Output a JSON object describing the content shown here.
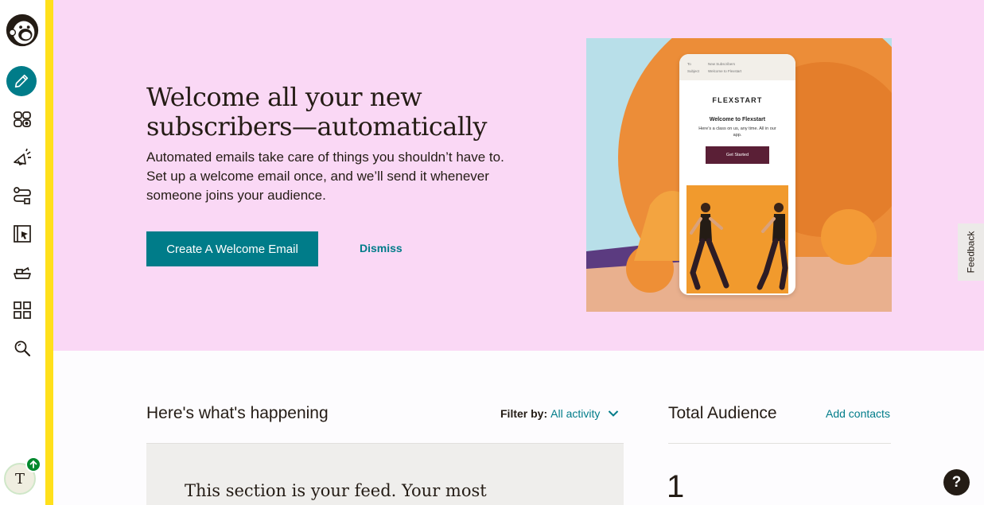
{
  "sidebar": {
    "items": [
      {
        "icon": "mailchimp-logo-icon"
      },
      {
        "icon": "pencil-icon"
      },
      {
        "icon": "audience-icon"
      },
      {
        "icon": "campaigns-icon"
      },
      {
        "icon": "automations-icon"
      },
      {
        "icon": "website-icon"
      },
      {
        "icon": "content-icon"
      },
      {
        "icon": "integrations-icon"
      },
      {
        "icon": "search-icon"
      }
    ],
    "avatar_initial": "T",
    "accent_color": "#ffe01b",
    "active_color": "#007c89"
  },
  "hero": {
    "title_line1": "Welcome all your new",
    "title_line2": "subscribers—automatically",
    "description": "Automated emails take care of things you shouldn’t have to. Set up a welcome email once, and we’ll send it whenever someone joins your audience.",
    "primary_button": "Create A Welcome Email",
    "dismiss_link": "Dismiss",
    "background": "#fad8f5"
  },
  "preview": {
    "to_label": "To",
    "to_value": "New Subscribers",
    "subject_label": "Subject",
    "subject_value": "Welcome to Flexstart",
    "brand": "FLEXSTART",
    "heading": "Welcome to Flexstart",
    "subtext": "Here’s a class on us, any time. All in our app.",
    "button": "Get Started"
  },
  "feedback_tab": "Feedback",
  "feed": {
    "title": "Here's what's happening",
    "filter_label": "Filter by:",
    "filter_value": "All activity",
    "card_text": "This section is your feed. Your most"
  },
  "audience": {
    "title": "Total Audience",
    "add_contacts": "Add contacts",
    "count": "1"
  },
  "help_button": "?"
}
